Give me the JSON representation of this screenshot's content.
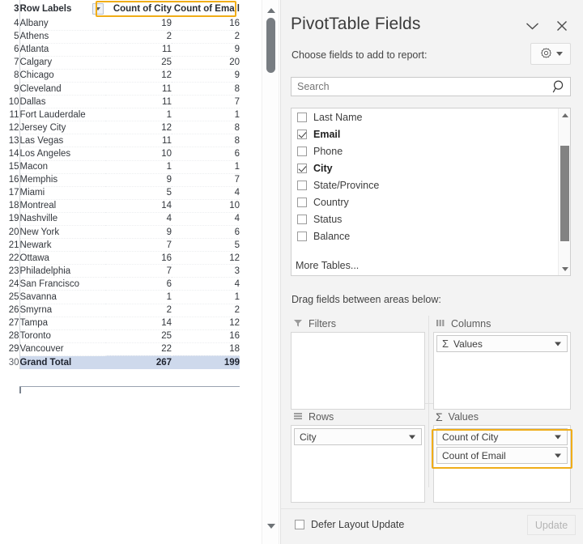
{
  "sheet": {
    "header": {
      "row_number": "3",
      "row_labels": "Row Labels",
      "col1": "Count of City",
      "col2": "Count of Email",
      "filter_icon": "filter-dropdown-icon"
    },
    "rows": [
      {
        "n": "4",
        "city": "Albany",
        "count_city": "19",
        "count_email": "16"
      },
      {
        "n": "5",
        "city": "Athens",
        "count_city": "2",
        "count_email": "2"
      },
      {
        "n": "6",
        "city": "Atlanta",
        "count_city": "11",
        "count_email": "9"
      },
      {
        "n": "7",
        "city": "Calgary",
        "count_city": "25",
        "count_email": "20"
      },
      {
        "n": "8",
        "city": "Chicago",
        "count_city": "12",
        "count_email": "9"
      },
      {
        "n": "9",
        "city": "Cleveland",
        "count_city": "11",
        "count_email": "8"
      },
      {
        "n": "10",
        "city": "Dallas",
        "count_city": "11",
        "count_email": "7"
      },
      {
        "n": "11",
        "city": "Fort Lauderdale",
        "count_city": "1",
        "count_email": "1"
      },
      {
        "n": "12",
        "city": "Jersey City",
        "count_city": "12",
        "count_email": "8"
      },
      {
        "n": "13",
        "city": "Las Vegas",
        "count_city": "11",
        "count_email": "8"
      },
      {
        "n": "14",
        "city": "Los Angeles",
        "count_city": "10",
        "count_email": "6"
      },
      {
        "n": "15",
        "city": "Macon",
        "count_city": "1",
        "count_email": "1"
      },
      {
        "n": "16",
        "city": "Memphis",
        "count_city": "9",
        "count_email": "7"
      },
      {
        "n": "17",
        "city": "Miami",
        "count_city": "5",
        "count_email": "4"
      },
      {
        "n": "18",
        "city": "Montreal",
        "count_city": "14",
        "count_email": "10"
      },
      {
        "n": "19",
        "city": "Nashville",
        "count_city": "4",
        "count_email": "4"
      },
      {
        "n": "20",
        "city": "New York",
        "count_city": "9",
        "count_email": "6"
      },
      {
        "n": "21",
        "city": "Newark",
        "count_city": "7",
        "count_email": "5"
      },
      {
        "n": "22",
        "city": "Ottawa",
        "count_city": "16",
        "count_email": "12"
      },
      {
        "n": "23",
        "city": "Philadelphia",
        "count_city": "7",
        "count_email": "3"
      },
      {
        "n": "24",
        "city": "San Francisco",
        "count_city": "6",
        "count_email": "4"
      },
      {
        "n": "25",
        "city": "Savanna",
        "count_city": "1",
        "count_email": "1"
      },
      {
        "n": "26",
        "city": "Smyrna",
        "count_city": "2",
        "count_email": "2"
      },
      {
        "n": "27",
        "city": "Tampa",
        "count_city": "14",
        "count_email": "12"
      },
      {
        "n": "28",
        "city": "Toronto",
        "count_city": "25",
        "count_email": "16"
      },
      {
        "n": "29",
        "city": "Vancouver",
        "count_city": "22",
        "count_email": "18"
      }
    ],
    "total": {
      "n": "30",
      "city": "Grand Total",
      "count_city": "267",
      "count_email": "199"
    },
    "highlight_color": "#f0ad18"
  },
  "pane": {
    "title": "PivotTable Fields",
    "collapse_icon": "chevron-down-icon",
    "close_icon": "close-icon",
    "subtitle": "Choose fields to add to report:",
    "tools_icon": "gear-icon",
    "tools_caret_icon": "chevron-down-icon",
    "search": {
      "placeholder": "Search",
      "value": "",
      "icon": "search-icon"
    },
    "fields": [
      {
        "label": "Last Name",
        "checked": false
      },
      {
        "label": "Email",
        "checked": true
      },
      {
        "label": "Phone",
        "checked": false
      },
      {
        "label": "City",
        "checked": true
      },
      {
        "label": "State/Province",
        "checked": false
      },
      {
        "label": "Country",
        "checked": false
      },
      {
        "label": "Status",
        "checked": false
      },
      {
        "label": "Balance",
        "checked": false
      }
    ],
    "more_tables": "More Tables...",
    "areas_label": "Drag fields between areas below:",
    "areas": {
      "filters": {
        "title": "Filters",
        "icon": "filter-icon",
        "items": []
      },
      "columns": {
        "title": "Columns",
        "icon": "columns-icon",
        "items": [
          {
            "label": "Values",
            "sigma": true
          }
        ]
      },
      "rows": {
        "title": "Rows",
        "icon": "rows-icon",
        "items": [
          {
            "label": "City",
            "sigma": false
          }
        ]
      },
      "values": {
        "title": "Values",
        "icon": "sigma-icon",
        "items": [
          {
            "label": "Count of City",
            "sigma": false
          },
          {
            "label": "Count of Email",
            "sigma": false
          }
        ]
      }
    },
    "footer": {
      "defer_label": "Defer Layout Update",
      "defer_checked": false,
      "update_label": "Update"
    },
    "highlight_color": "#f0ad18"
  },
  "scrollbar": {
    "up_icon": "scroll-up-arrow-icon",
    "down_icon": "scroll-down-arrow-icon"
  }
}
